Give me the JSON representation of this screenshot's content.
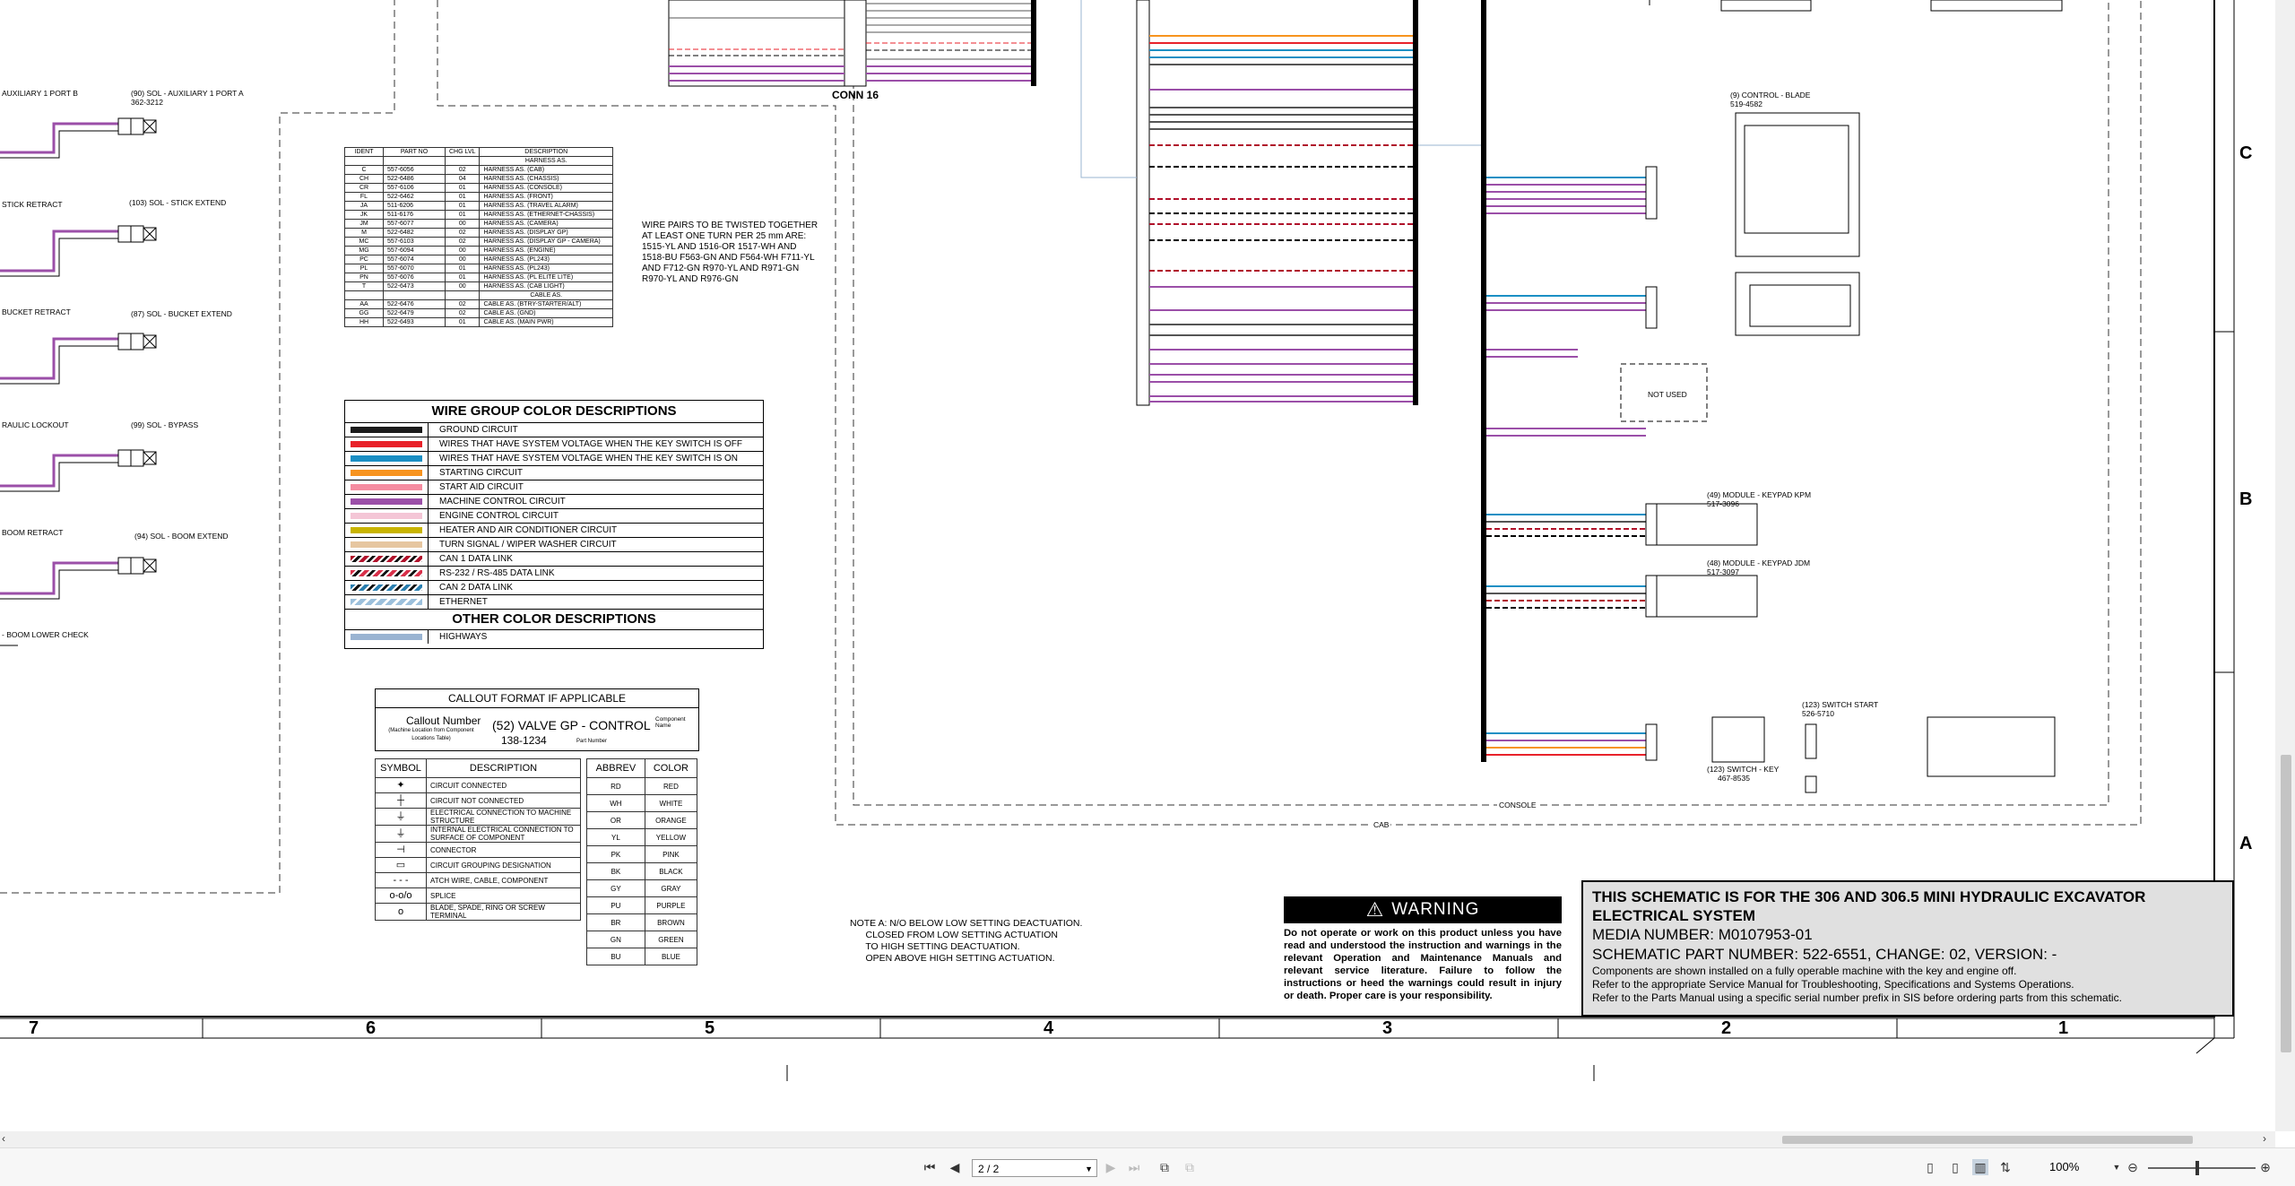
{
  "drawing": {
    "conn_label": "CONN 16",
    "labels_left": [
      {
        "text": "AUXILIARY 1 PORT B"
      },
      {
        "text": "(90) SOL - AUXILIARY 1 PORT A"
      },
      {
        "text": "362-3212"
      },
      {
        "text": "STICK RETRACT"
      },
      {
        "text": "(103) SOL - STICK EXTEND"
      },
      {
        "text": "BUCKET RETRACT"
      },
      {
        "text": "(87) SOL - BUCKET EXTEND"
      },
      {
        "text": "RAULIC LOCKOUT"
      },
      {
        "text": "(99) SOL - BYPASS"
      },
      {
        "text": "BOOM RETRACT"
      },
      {
        "text": "(94) SOL - BOOM EXTEND"
      },
      {
        "text": "- BOOM LOWER CHECK"
      }
    ],
    "labels_right": [
      {
        "text": "(9) CONTROL - BLADE"
      },
      {
        "text": "519-4582"
      },
      {
        "text": "NOT USED"
      },
      {
        "text": "(49) MODULE - KEYPAD KPM"
      },
      {
        "text": "517-3096"
      },
      {
        "text": "(48) MODULE - KEYPAD JDM"
      },
      {
        "text": "517-3097"
      },
      {
        "text": "(123) SWITCH START"
      },
      {
        "text": "526-5710"
      },
      {
        "text": "(123) SWITCH - KEY"
      },
      {
        "text": "467-8535"
      }
    ],
    "console_label": "CONSOLE",
    "cab_label": "CAB",
    "zone_letters": [
      "C",
      "B",
      "A"
    ],
    "zone_numbers": [
      "7",
      "6",
      "5",
      "4",
      "3",
      "2",
      "1"
    ],
    "twist_note": "WIRE PAIRS TO BE TWISTED TOGETHER AT LEAST ONE TURN PER 25 mm ARE: 1515-YL AND 1516-OR 1517-WH AND 1518-BU F563-GN AND F564-WH F711-YL AND F712-GN R970-YL AND R971-GN R970-YL AND R976-GN"
  },
  "ident_table": {
    "headers": [
      "IDENT",
      "PART NO",
      "CHG LVL",
      "DESCRIPTION"
    ],
    "rows": [
      [
        "",
        "",
        "",
        "HARNESS AS."
      ],
      [
        "C",
        "557-6056",
        "02",
        "HARNESS AS. (CAB)"
      ],
      [
        "CH",
        "522-6486",
        "04",
        "HARNESS AS. (CHASSIS)"
      ],
      [
        "CR",
        "557-6106",
        "01",
        "HARNESS AS. (CONSOLE)"
      ],
      [
        "FL",
        "522-6462",
        "01",
        "HARNESS AS. (FRONT)"
      ],
      [
        "JA",
        "511-6206",
        "01",
        "HARNESS AS. (TRAVEL ALARM)"
      ],
      [
        "JK",
        "511-6176",
        "01",
        "HARNESS AS. (ETHERNET-CHASSIS)"
      ],
      [
        "JM",
        "557-6077",
        "00",
        "HARNESS AS. (CAMERA)"
      ],
      [
        "M",
        "522-6482",
        "02",
        "HARNESS AS. (DISPLAY GP)"
      ],
      [
        "MC",
        "557-6103",
        "02",
        "HARNESS AS. (DISPLAY GP - CAMERA)"
      ],
      [
        "MG",
        "557-6094",
        "00",
        "HARNESS AS. (ENGINE)"
      ],
      [
        "PC",
        "557-6074",
        "00",
        "HARNESS AS. (PL243)"
      ],
      [
        "PL",
        "557-6070",
        "01",
        "HARNESS AS. (PL243)"
      ],
      [
        "PN",
        "557-6076",
        "01",
        "HARNESS AS. (PL ELITE LITE)"
      ],
      [
        "T",
        "522-6473",
        "00",
        "HARNESS AS. (CAB LIGHT)"
      ],
      [
        "",
        "",
        "",
        "CABLE AS."
      ],
      [
        "AA",
        "522-6476",
        "02",
        "CABLE AS. (BTRY-STARTER/ALT)"
      ],
      [
        "GG",
        "522-6479",
        "02",
        "CABLE AS. (GND)"
      ],
      [
        "HH",
        "522-6493",
        "01",
        "CABLE AS. (MAIN PWR)"
      ]
    ]
  },
  "wire_group": {
    "title": "WIRE GROUP COLOR DESCRIPTIONS",
    "items": [
      {
        "label": "GROUND CIRCUIT",
        "color": "#1a1a1a",
        "pattern": "solid"
      },
      {
        "label": "WIRES THAT HAVE SYSTEM VOLTAGE WHEN THE KEY SWITCH IS OFF",
        "color": "#e8222a",
        "pattern": "solid"
      },
      {
        "label": "WIRES THAT HAVE SYSTEM VOLTAGE WHEN THE KEY SWITCH IS ON",
        "color": "#1b8fc4",
        "pattern": "solid"
      },
      {
        "label": "STARTING CIRCUIT",
        "color": "#f7931e",
        "pattern": "solid"
      },
      {
        "label": "START AID CIRCUIT",
        "color": "#f58ca0",
        "pattern": "solid"
      },
      {
        "label": "MACHINE CONTROL CIRCUIT",
        "color": "#9b4fa8",
        "pattern": "solid"
      },
      {
        "label": "ENGINE CONTROL CIRCUIT",
        "color": "#f4c6d6",
        "pattern": "solid"
      },
      {
        "label": "HEATER AND AIR CONDITIONER CIRCUIT",
        "color": "#c8b400",
        "pattern": "solid"
      },
      {
        "label": "TURN SIGNAL / WIPER WASHER CIRCUIT",
        "color": "#e6c6a0",
        "pattern": "solid"
      },
      {
        "label": "CAN 1 DATA LINK",
        "color": "#b0102a",
        "pattern": "hatch"
      },
      {
        "label": "RS-232 / RS-485 DATA LINK",
        "color": "#d8304a",
        "pattern": "hatch"
      },
      {
        "label": "CAN 2 DATA LINK",
        "color": "#2a7fb0",
        "pattern": "hatch"
      },
      {
        "label": "ETHERNET",
        "color": "#9cc0dc",
        "pattern": "hatch-light"
      }
    ],
    "other_title": "OTHER COLOR DESCRIPTIONS",
    "other_items": [
      {
        "label": "HIGHWAYS",
        "color": "#9ab4d2",
        "pattern": "solid"
      }
    ]
  },
  "callout": {
    "title": "CALLOUT FORMAT IF APPLICABLE",
    "label": "Callout Number",
    "label_sub": "(Machine Location from Component Locations Table)",
    "value": "(52) VALVE GP - CONTROL",
    "part": "138-1234",
    "part_note": "Part Number",
    "component_note": "Component Name"
  },
  "symbol_table": {
    "headers": [
      "SYMBOL",
      "DESCRIPTION"
    ],
    "rows": [
      {
        "symbol": "✦",
        "desc": "CIRCUIT CONNECTED"
      },
      {
        "symbol": "┼",
        "desc": "CIRCUIT NOT CONNECTED"
      },
      {
        "symbol": "⏚",
        "desc": "ELECTRICAL CONNECTION TO MACHINE STRUCTURE"
      },
      {
        "symbol": "⏚",
        "desc": "INTERNAL ELECTRICAL CONNECTION TO SURFACE OF COMPONENT"
      },
      {
        "symbol": "⊣",
        "desc": "CONNECTOR"
      },
      {
        "symbol": "▭",
        "desc": "CIRCUIT GROUPING DESIGNATION"
      },
      {
        "symbol": "- - -",
        "desc": "ATCH WIRE, CABLE, COMPONENT"
      },
      {
        "symbol": "o-o/o",
        "desc": "SPLICE"
      },
      {
        "symbol": "o",
        "desc": "BLADE, SPADE, RING OR SCREW TERMINAL"
      }
    ]
  },
  "abbrev_table": {
    "headers": [
      "ABBREV",
      "COLOR"
    ],
    "rows": [
      [
        "RD",
        "RED"
      ],
      [
        "WH",
        "WHITE"
      ],
      [
        "OR",
        "ORANGE"
      ],
      [
        "YL",
        "YELLOW"
      ],
      [
        "PK",
        "PINK"
      ],
      [
        "BK",
        "BLACK"
      ],
      [
        "GY",
        "GRAY"
      ],
      [
        "PU",
        "PURPLE"
      ],
      [
        "BR",
        "BROWN"
      ],
      [
        "GN",
        "GREEN"
      ],
      [
        "BU",
        "BLUE"
      ]
    ]
  },
  "note_a": "NOTE A: N/O BELOW LOW SETTING DEACTUATION.\n      CLOSED FROM LOW SETTING ACTUATION\n      TO HIGH SETTING DEACTUATION.\n      OPEN ABOVE HIGH SETTING ACTUATION.",
  "warning": {
    "title": "WARNING",
    "body": "Do not operate or work on this product unless you have read and understood the instruction and warnings in the relevant Operation and Maintenance Manuals and relevant service literature. Failure to follow the instructions or heed the warnings could result in injury or death. Proper care is your responsibility."
  },
  "title_block": {
    "line1": "THIS SCHEMATIC IS FOR THE 306 AND 306.5 MINI HYDRAULIC EXCAVATOR",
    "line2": "ELECTRICAL SYSTEM",
    "media": "MEDIA NUMBER: M0107953-01",
    "part": "SCHEMATIC PART NUMBER: 522-6551, CHANGE: 02, VERSION: -",
    "note1": "Components are shown installed on a fully operable machine with the key and engine off.",
    "note2": "Refer to the appropriate Service Manual for Troubleshooting, Specifications and Systems Operations.",
    "note3": "Refer to the Parts Manual using a specific serial number prefix in SIS before ordering parts from this schematic."
  },
  "viewer": {
    "page_value": "2 / 2",
    "zoom": "100%",
    "icons": [
      "first-page-icon",
      "prev-page-icon",
      "next-page-icon",
      "last-page-icon"
    ]
  }
}
